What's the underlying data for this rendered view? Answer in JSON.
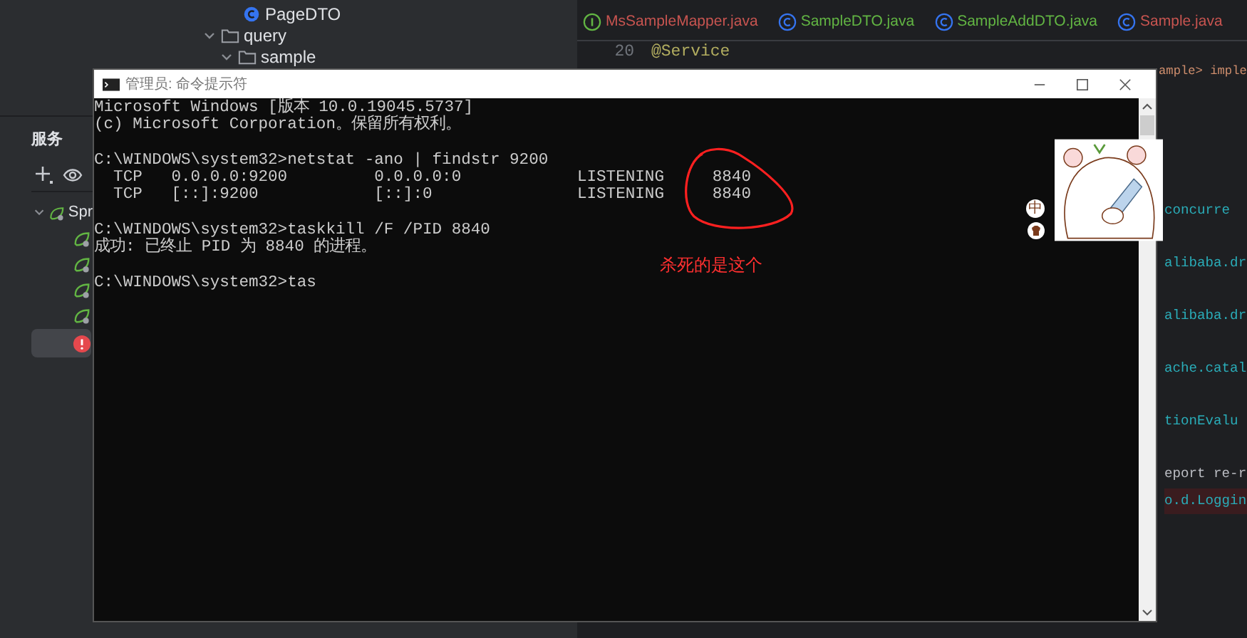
{
  "project_tree": {
    "items": [
      {
        "label": "PageDTO",
        "kind": "class"
      },
      {
        "label": "query",
        "kind": "folder",
        "expanded": true,
        "children": [
          {
            "label": "sample",
            "kind": "folder",
            "expanded": true
          }
        ]
      }
    ]
  },
  "services": {
    "title": "服务",
    "tree": [
      {
        "label": "Spr",
        "expanded": true,
        "children": [
          {
            "kind": "running",
            "selected": false
          },
          {
            "kind": "running",
            "selected": false
          },
          {
            "kind": "running",
            "selected": false
          },
          {
            "kind": "running",
            "selected": false
          },
          {
            "kind": "error",
            "selected": true
          }
        ]
      }
    ]
  },
  "editor": {
    "tabs": [
      {
        "label": "MsSampleMapper.java",
        "kind": "interface",
        "color": "#c75450"
      },
      {
        "label": "SampleDTO.java",
        "kind": "class",
        "color": "#62b543"
      },
      {
        "label": "SampleAddDTO.java",
        "kind": "class",
        "color": "#62b543"
      },
      {
        "label": "Sample.java",
        "kind": "class",
        "color": "#c75450"
      }
    ],
    "lines": [
      {
        "number": "20",
        "text": "@Service"
      },
      {
        "text": "ample> imple"
      }
    ],
    "visible_fragments": [
      {
        "text": "concurre",
        "highlight": false
      },
      {
        "text": "alibaba.dr",
        "highlight": false
      },
      {
        "text": "alibaba.dr",
        "highlight": false
      },
      {
        "text": "ache.catal",
        "highlight": false
      },
      {
        "text": "tionEvalu",
        "highlight": false
      },
      {
        "text": "eport re-r",
        "highlight": false
      },
      {
        "text": "o.d.Loggin",
        "highlight": true
      }
    ]
  },
  "console_window": {
    "title": "管理员: 命令提示符",
    "blocks": [
      {
        "lines": [
          "Microsoft Windows [版本 10.0.19045.5737]",
          "(c) Microsoft Corporation。保留所有权利。"
        ]
      },
      {
        "lines": [
          "C:\\WINDOWS\\system32>netstat -ano | findstr 9200",
          "  TCP   0.0.0.0:9200         0.0.0.0:0            LISTENING     8840",
          "  TCP   [::]:9200            [::]:0               LISTENING     8840"
        ]
      },
      {
        "lines": [
          "C:\\WINDOWS\\system32>taskkill /F /PID 8840",
          "成功: 已终止 PID 为 8840 的进程。"
        ]
      },
      {
        "lines": [
          "C:\\WINDOWS\\system32>tas"
        ]
      }
    ],
    "annotation": "杀死的是这个"
  },
  "ime": {
    "mode": "中"
  }
}
